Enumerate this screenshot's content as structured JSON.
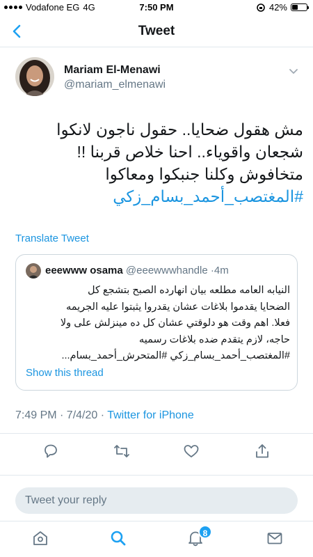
{
  "status_bar": {
    "carrier": "Vodafone EG",
    "network": "4G",
    "time": "7:50 PM",
    "battery": "42%",
    "battery_level": 0.42
  },
  "header": {
    "title": "Tweet",
    "back_icon": "chevron-left-icon"
  },
  "tweet": {
    "author_name": "Mariam El-Menawi",
    "author_handle": "@mariam_elmenawi",
    "lines": [
      "مش هقول ضحايا.. حقول ناجون لانكوا",
      "شجعان واقوياء.. احنا خلاص قربنا !!",
      "متخافوش وكلنا جنبكوا ومعاكوا"
    ],
    "hashtag": "#المغتصب_أحمد_بسام_زكي",
    "translate_label": "Translate Tweet",
    "timestamp": "7:49 PM · 7/4/20 · ",
    "source": "Twitter for iPhone"
  },
  "quote": {
    "author_name": "eeewww osama",
    "author_handle": "@eeewwwhandle",
    "time": "·4m",
    "lines": [
      "النيابه العامه مطلعه بيان انهارده الصبح بتشجع كل",
      "الضحايا يقدموا بلاغات عشان يقدروا يثبتوا عليه الجريمه",
      "فعلا. اهم وقت هو دلوقتي عشان كل ده مينزلش على ولا",
      "حاجه، لازم يتقدم ضده بلاغات رسميه",
      "#المغتصب_أحمد_بسام_زكي #المتحرش_أحمد_بسام..."
    ],
    "show_thread": "Show this thread"
  },
  "actions": [
    "reply-icon",
    "retweet-icon",
    "like-icon",
    "share-icon"
  ],
  "reply": {
    "placeholder": "Tweet your reply"
  },
  "bottom_nav": {
    "items": [
      "home-icon",
      "search-icon",
      "notifications-icon",
      "messages-icon"
    ],
    "notifications_badge": "8"
  },
  "colors": {
    "accent": "#1da1f2",
    "link": "#1b95e0",
    "secondary_text": "#657786"
  }
}
